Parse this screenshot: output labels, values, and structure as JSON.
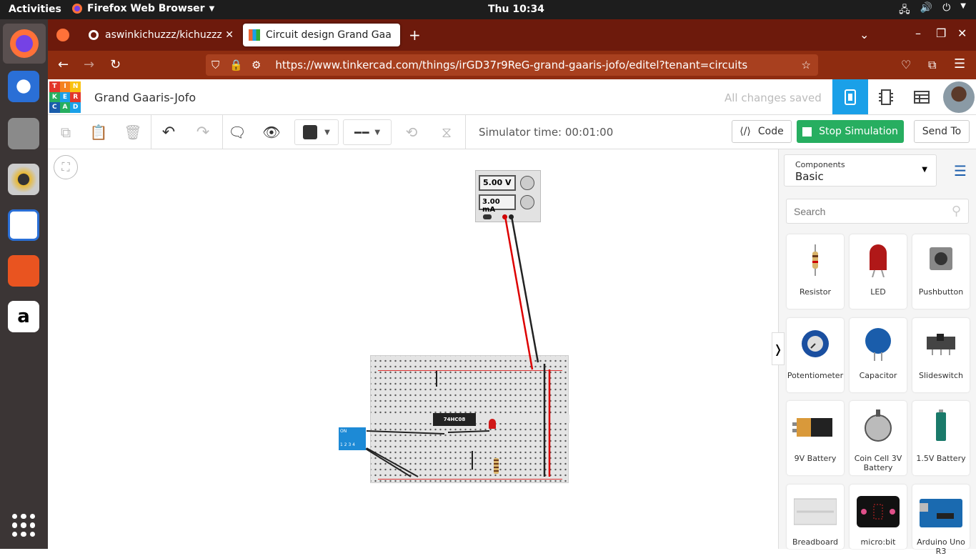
{
  "topbar": {
    "activities": "Activities",
    "app": "Firefox Web Browser",
    "clock": "Thu 10:34"
  },
  "browser": {
    "tabs": [
      {
        "label": "aswinkichuzzz/kichuzzz"
      },
      {
        "label": "Circuit design Grand Gaa"
      }
    ],
    "url": "https://www.tinkercad.com/things/irGD37r9ReG-grand-gaaris-jofo/editel?tenant=circuits"
  },
  "app": {
    "logo": [
      "TIN",
      "KER",
      "CAD"
    ],
    "title": "Grand Gaaris-Jofo",
    "save_status": "All changes saved"
  },
  "toolbar": {
    "sim_time": "Simulator time: 00:01:00",
    "code": "Code",
    "stop": "Stop Simulation",
    "send": "Send To"
  },
  "supply": {
    "voltage": "5.00 V",
    "current": "3.00 mA"
  },
  "chip": {
    "label": "74HC08"
  },
  "dip": {
    "label": "ON",
    "numbers": "1 2 3 4"
  },
  "panel": {
    "components_label": "Components",
    "category": "Basic",
    "search_placeholder": "Search",
    "items": [
      {
        "label": "Resistor"
      },
      {
        "label": "LED"
      },
      {
        "label": "Pushbutton"
      },
      {
        "label": "Potentiometer"
      },
      {
        "label": "Capacitor"
      },
      {
        "label": "Slideswitch"
      },
      {
        "label": "9V Battery"
      },
      {
        "label": "Coin Cell 3V Battery"
      },
      {
        "label": "1.5V Battery"
      },
      {
        "label": "Breadboard"
      },
      {
        "label": "micro:bit"
      },
      {
        "label": "Arduino Uno R3"
      }
    ]
  },
  "colors": {
    "tab_bar": "#6d1a0c",
    "nav_bar": "#8e2c10",
    "accent_blue": "#1aa0e8",
    "stop_green": "#27ae60"
  }
}
